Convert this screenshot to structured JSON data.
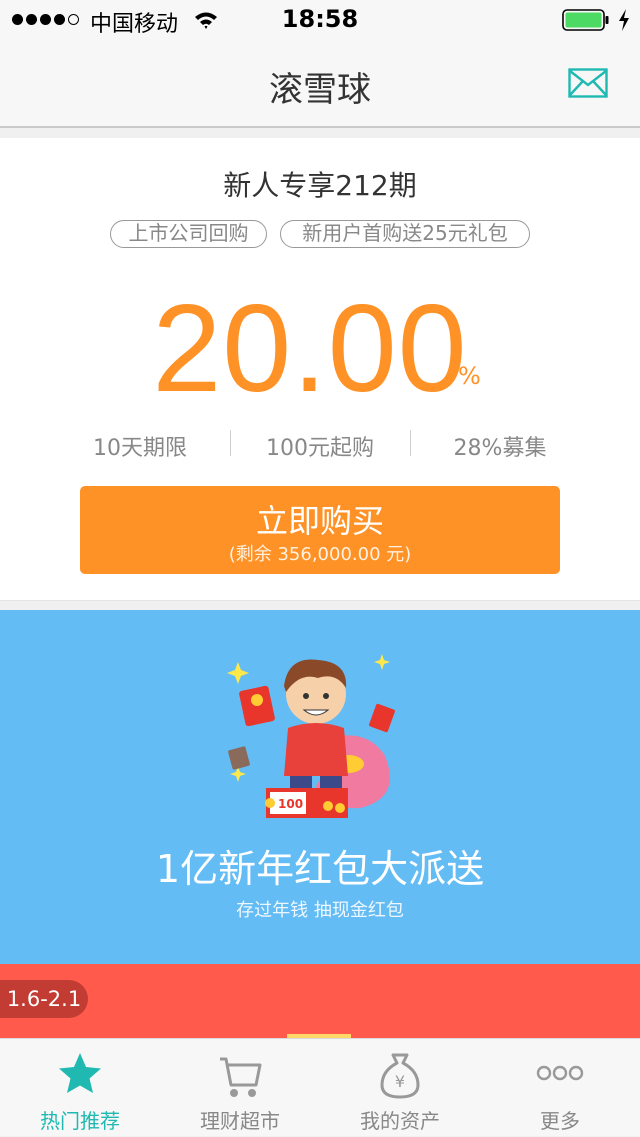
{
  "status_bar": {
    "carrier": "中国移动",
    "time": "18:58",
    "signal_bars": 4,
    "signal_total": 5,
    "battery_color": "#4cd964"
  },
  "nav": {
    "title": "滚雪球",
    "mail_icon": "mail-icon",
    "accent_color": "#1fb9b2"
  },
  "product": {
    "title": "新人专享212期",
    "tags": [
      "上市公司回购",
      "新用户首购送25元礼包"
    ],
    "rate": "20.00",
    "rate_unit": "%",
    "specs": [
      "10天期限",
      "100元起购",
      "28%募集"
    ],
    "buy_label": "立即购买",
    "remaining": "(剩余 356,000.00 元)",
    "accent_color": "#ff9226"
  },
  "banner": {
    "title": "1亿新年红包大派送",
    "subtitle": "存过年钱 抽现金红包",
    "card_value": "100",
    "background": "#64bcf5"
  },
  "event": {
    "date_range": "1.6-2.1",
    "background": "#ff5a4b"
  },
  "tabs": [
    {
      "label": "热门推荐",
      "icon": "star-icon",
      "active": true
    },
    {
      "label": "理财超市",
      "icon": "cart-icon",
      "active": false
    },
    {
      "label": "我的资产",
      "icon": "money-bag-icon",
      "active": false
    },
    {
      "label": "更多",
      "icon": "more-icon",
      "active": false
    }
  ]
}
